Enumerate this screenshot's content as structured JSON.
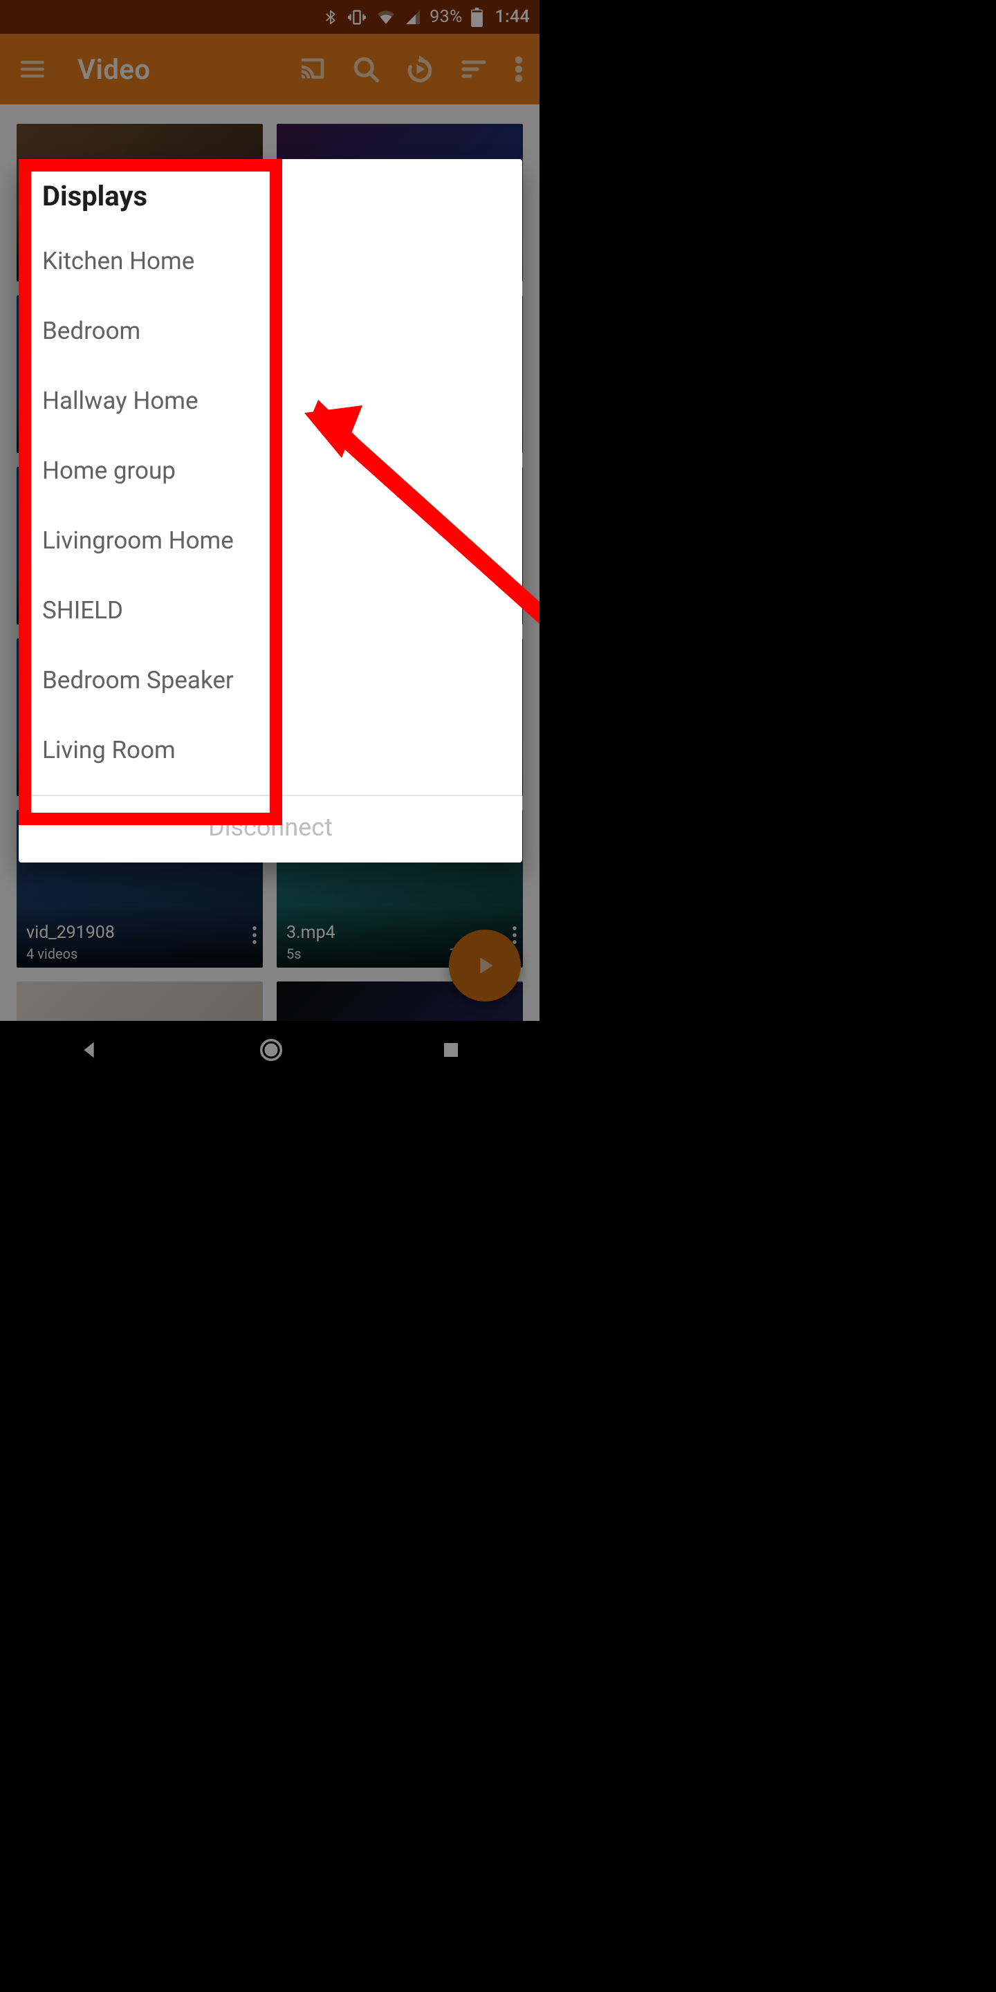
{
  "statusbar": {
    "battery_pct": "93%",
    "time": "1:44"
  },
  "appbar": {
    "title": "Video"
  },
  "dialog": {
    "title": "Displays",
    "items": [
      "Kitchen Home",
      "Bedroom",
      "Hallway Home",
      "Home group",
      "Livingroom Home",
      "SHIELD",
      "Bedroom Speaker",
      "Living Room"
    ],
    "action": "Disconnect"
  },
  "tiles": [
    {
      "title": "",
      "sub_l": "",
      "sub_r": "",
      "bg": "bg-a"
    },
    {
      "title": "",
      "sub_l": "",
      "sub_r": "",
      "bg": "bg-b"
    },
    {
      "title": "",
      "sub_l": "",
      "sub_r": "",
      "bg": "bg-c"
    },
    {
      "title": "",
      "sub_l": "",
      "sub_r": "",
      "bg": "bg-c"
    },
    {
      "title": "",
      "sub_l": "",
      "sub_r": "",
      "bg": "bg-c"
    },
    {
      "title": "",
      "sub_l": "",
      "sub_r": "",
      "bg": "bg-c"
    },
    {
      "title": "",
      "sub_l": "",
      "sub_r": "",
      "bg": "bg-c"
    },
    {
      "title": "",
      "sub_l": "",
      "sub_r": "",
      "bg": "bg-c"
    },
    {
      "title": "vid_291908",
      "sub_l": "4 videos",
      "sub_r": "",
      "bg": "bg-d"
    },
    {
      "title": "3.mp4",
      "sub_l": "5s",
      "sub_r": "720x13",
      "bg": "bg-e"
    },
    {
      "title": "",
      "sub_l": "",
      "sub_r": "",
      "bg": "bg-f"
    },
    {
      "title": "",
      "sub_l": "",
      "sub_r": "",
      "bg": "bg-g"
    }
  ],
  "colors": {
    "accent": "#e17b1a",
    "status": "#7a2d06",
    "fab": "#c86a12",
    "hilite": "#ff0000"
  }
}
